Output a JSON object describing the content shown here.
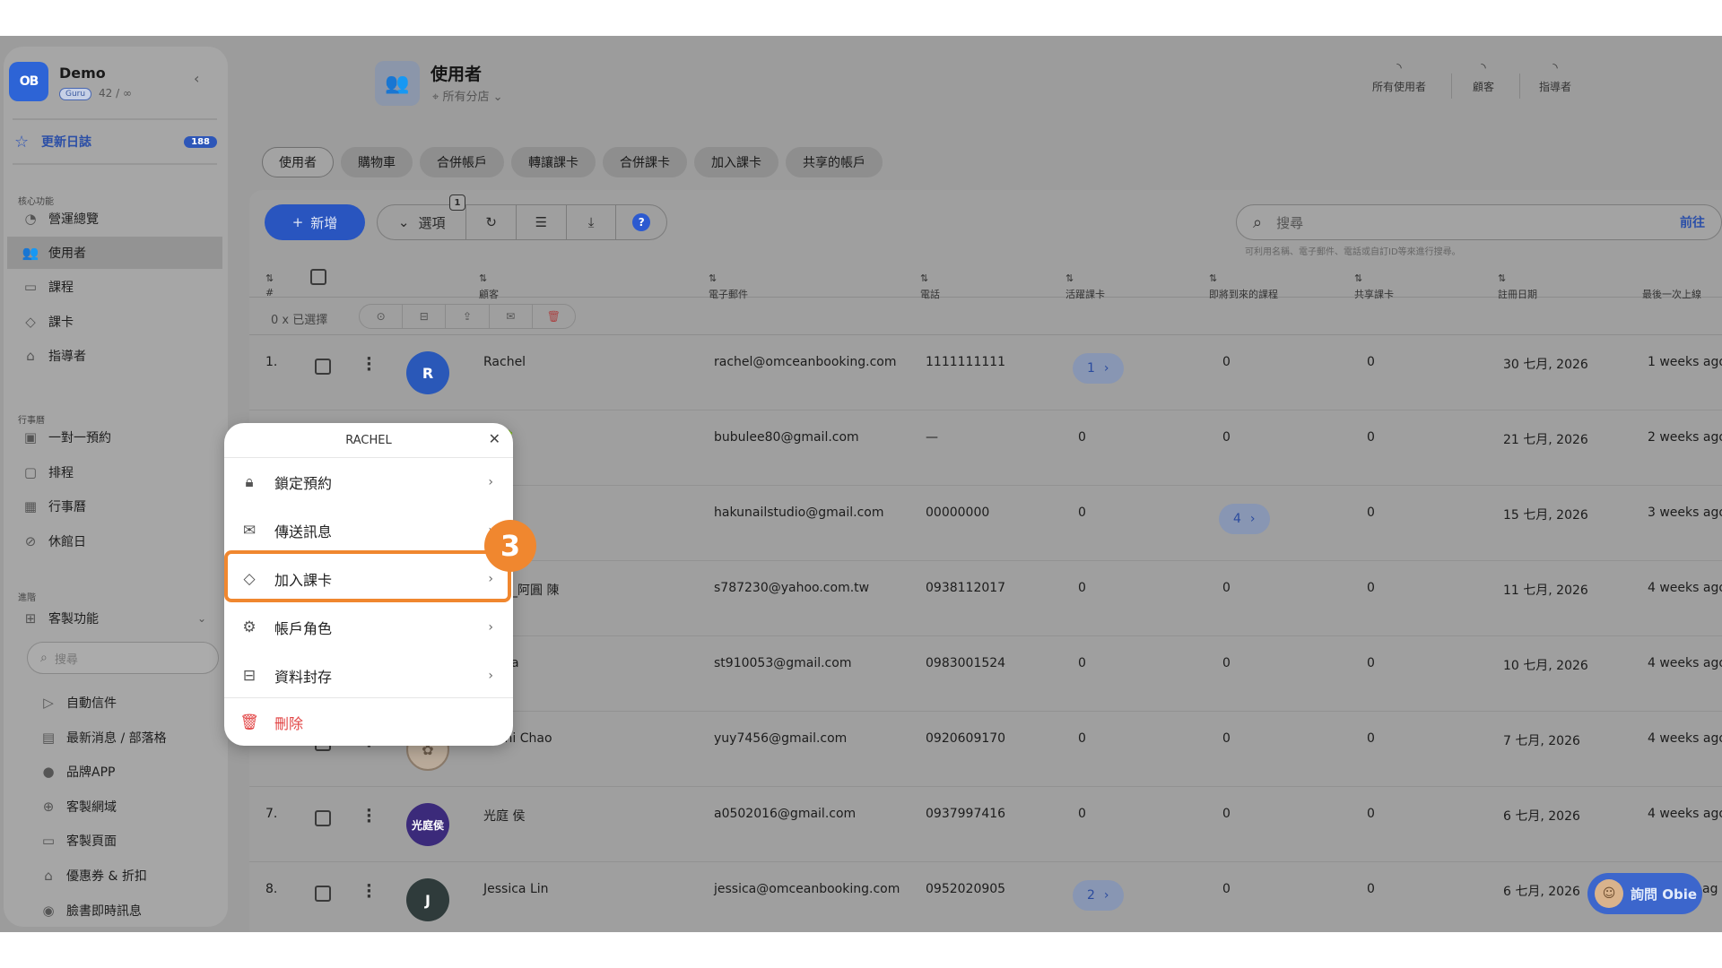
{
  "sidebar": {
    "logo_text": "OB",
    "brand_name": "Demo",
    "brand_badge": "Guru",
    "brand_count": "42 / ∞",
    "changelog_label": "更新日誌",
    "changelog_count": "188",
    "sections": {
      "core": "核心功能",
      "calendar": "行事曆",
      "advanced": "進階"
    },
    "core_items": [
      {
        "label": "營運總覽",
        "icon": "dashboard-icon"
      },
      {
        "label": "使用者",
        "icon": "users-icon"
      },
      {
        "label": "課程",
        "icon": "monitor-icon"
      },
      {
        "label": "課卡",
        "icon": "tag-icon"
      },
      {
        "label": "指導者",
        "icon": "graduation-cap-icon"
      }
    ],
    "calendar_items": [
      {
        "label": "一對一預約",
        "icon": "calendar-31-icon"
      },
      {
        "label": "排程",
        "icon": "calendar-icon"
      },
      {
        "label": "行事曆",
        "icon": "calendar-grid-icon"
      },
      {
        "label": "休館日",
        "icon": "ban-icon"
      }
    ],
    "custom_label": "客製功能",
    "search_placeholder": "搜尋",
    "custom_items": [
      {
        "label": "自動信件",
        "icon": "send-icon"
      },
      {
        "label": "最新消息 / 部落格",
        "icon": "news-icon"
      },
      {
        "label": "品牌APP",
        "icon": "app-store-icon"
      },
      {
        "label": "客製網域",
        "icon": "globe-icon"
      },
      {
        "label": "客製頁面",
        "icon": "desktop-icon"
      },
      {
        "label": "優惠券 & 折扣",
        "icon": "coupon-icon"
      },
      {
        "label": "臉書即時訊息",
        "icon": "messenger-icon"
      }
    ]
  },
  "header": {
    "title": "使用者",
    "branch": "所有分店",
    "stats": [
      {
        "label": "所有使用者"
      },
      {
        "label": "顧客"
      },
      {
        "label": "指導者"
      }
    ]
  },
  "tabs": [
    "使用者",
    "購物車",
    "合併帳戶",
    "轉讓課卡",
    "合併課卡",
    "加入課卡",
    "共享的帳戶"
  ],
  "toolbar": {
    "add_label": "新增",
    "options_label": "選項",
    "options_badge": "1",
    "search_placeholder": "搜尋",
    "search_go": "前往",
    "search_hint": "可利用名稱、電子郵件、電話或自訂ID等來進行搜尋。"
  },
  "table": {
    "headers": [
      "#",
      "顧客",
      "電子郵件",
      "電話",
      "活躍課卡",
      "即將到來的課程",
      "共享課卡",
      "註冊日期",
      "最後一次上線"
    ],
    "selected_label": "0 x 已選擇",
    "rows": [
      {
        "index": "1.",
        "avatar": "R",
        "name": "Rachel",
        "email": "rachel@omceanbooking.com",
        "phone": "1111111111",
        "active_cards": "1",
        "upcoming": "0",
        "shared": "0",
        "registered": "30 七月, 2026",
        "last_online": "1 weeks ago"
      },
      {
        "index": "2.",
        "avatar": "",
        "name": "🍀🍀",
        "email": "bubulee80@gmail.com",
        "phone": "—",
        "active_cards": "0",
        "upcoming": "0",
        "shared": "0",
        "registered": "21 七月, 2026",
        "last_online": "2 weeks ago"
      },
      {
        "index": "3.",
        "avatar": "",
        "name": "",
        "email": "hakunailstudio@gmail.com",
        "phone": "00000000",
        "active_cards": "0",
        "upcoming": "4",
        "shared": "0",
        "registered": "15 七月, 2026",
        "last_online": "3 weeks ago"
      },
      {
        "index": "4.",
        "avatar": "",
        "name": "_阿圓 陳",
        "email": "s787230@yahoo.com.tw",
        "phone": "0938112017",
        "active_cards": "0",
        "upcoming": "0",
        "shared": "0",
        "registered": "11 七月, 2026",
        "last_online": "4 weeks ago"
      },
      {
        "index": "5.",
        "avatar": "",
        "name": "a",
        "email": "st910053@gmail.com",
        "phone": "0983001524",
        "active_cards": "0",
        "upcoming": "0",
        "shared": "0",
        "registered": "10 七月, 2026",
        "last_online": "4 weeks ago"
      },
      {
        "index": "6.",
        "avatar": "",
        "name": "Yuchi Chao",
        "email": "yuy7456@gmail.com",
        "phone": "0920609170",
        "active_cards": "0",
        "upcoming": "0",
        "shared": "0",
        "registered": "7 七月, 2026",
        "last_online": "4 weeks ago"
      },
      {
        "index": "7.",
        "avatar": "光庭侯",
        "name": "光庭 侯",
        "email": "a0502016@gmail.com",
        "phone": "0937997416",
        "active_cards": "0",
        "upcoming": "0",
        "shared": "0",
        "registered": "6 七月, 2026",
        "last_online": "4 weeks ago"
      },
      {
        "index": "8.",
        "avatar": "J",
        "name": "Jessica Lin",
        "email": "jessica@omceanbooking.com",
        "phone": "0952020905",
        "active_cards": "2",
        "upcoming": "0",
        "shared": "0",
        "registered": "6 七月, 2026",
        "last_online": "ag"
      }
    ]
  },
  "popup": {
    "title": "RACHEL",
    "items": [
      {
        "label": "鎖定預約",
        "icon": "lock-icon"
      },
      {
        "label": "傳送訊息",
        "icon": "mail-icon"
      },
      {
        "label": "加入課卡",
        "icon": "tag-icon"
      },
      {
        "label": "帳戶角色",
        "icon": "gear-icon"
      },
      {
        "label": "資料封存",
        "icon": "archive-icon"
      }
    ],
    "delete_label": "刪除"
  },
  "step_number": "3",
  "assistant_label": "詢問 Obie",
  "colors": {
    "accent": "#2955bf",
    "highlight": "#f0872f",
    "danger": "#e24545"
  }
}
